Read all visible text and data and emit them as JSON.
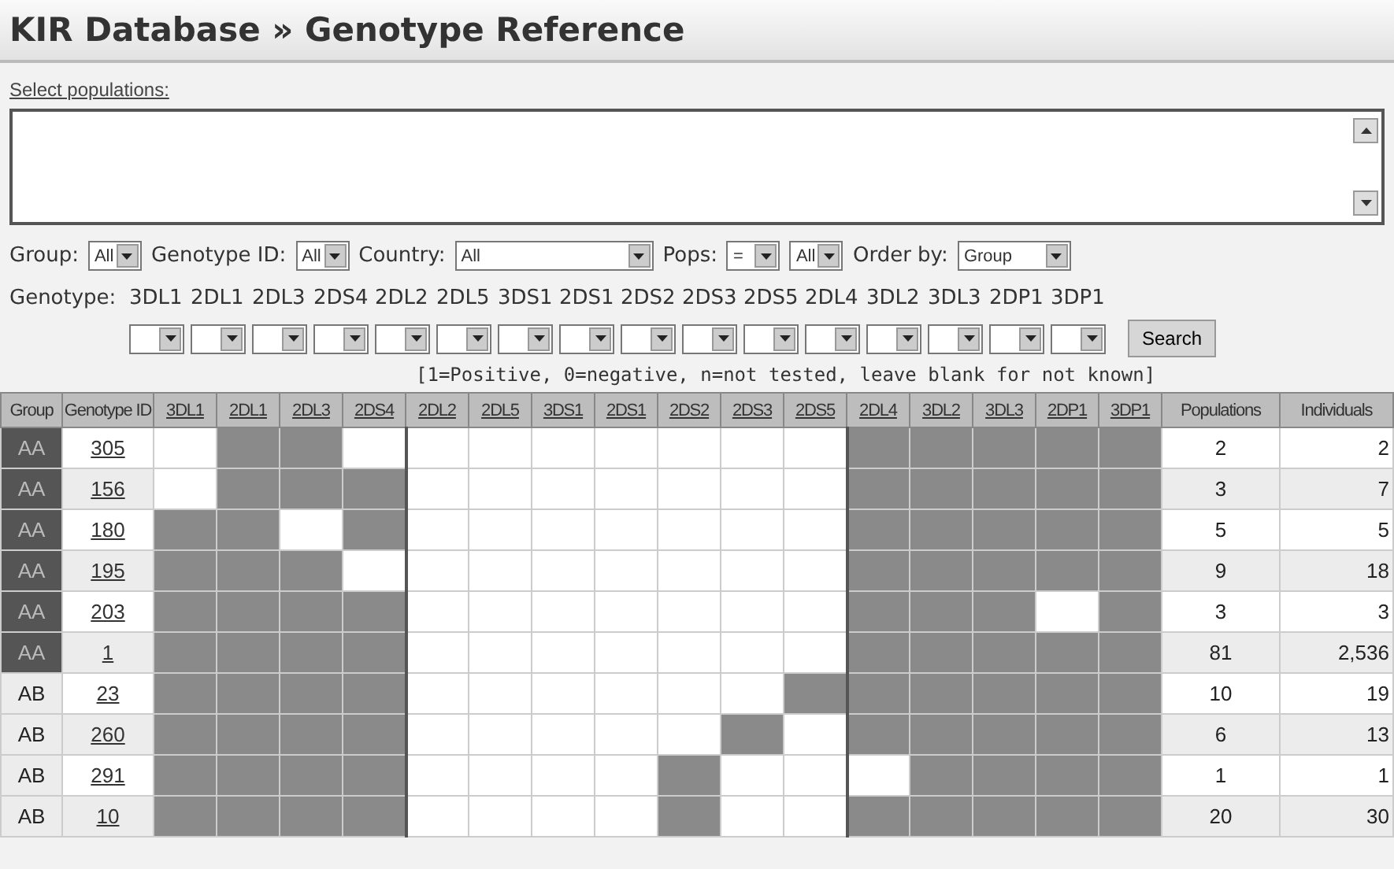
{
  "page_title": "KIR Database » Genotype Reference",
  "select_populations": {
    "label": "Select populations:"
  },
  "filters": [
    {
      "label": "Group:",
      "value": "All"
    },
    {
      "label": "Genotype ID:",
      "value": "All"
    },
    {
      "label": "Country:",
      "value": "All"
    },
    {
      "label": "Pops:",
      "value": "="
    },
    {
      "value": "All"
    },
    {
      "label": "Order by:",
      "value": "Group"
    }
  ],
  "genotype_label": "Genotype:",
  "genes": [
    "3DL1",
    "2DL1",
    "2DL3",
    "2DS4",
    "2DL2",
    "2DL5",
    "3DS1",
    "2DS1",
    "2DS2",
    "2DS3",
    "2DS5",
    "2DL4",
    "3DL2",
    "3DL3",
    "2DP1",
    "3DP1"
  ],
  "search_button": "Search",
  "hint": "[1=Positive, 0=negative, n=not tested, leave blank for not known]",
  "table": {
    "columns": {
      "group": "Group",
      "genotype_id": "Genotype ID",
      "genes": [
        "3DL1",
        "2DL1",
        "2DL3",
        "2DS4",
        "2DL2",
        "2DL5",
        "3DS1",
        "2DS1",
        "2DS2",
        "2DS3",
        "2DS5",
        "2DL4",
        "3DL2",
        "3DL3",
        "2DP1",
        "3DP1"
      ],
      "populations": "Populations",
      "individuals": "Individuals"
    },
    "rows": [
      {
        "group": "AA",
        "highlighted": true,
        "id": "305",
        "present": [
          false,
          true,
          true,
          false,
          false,
          false,
          false,
          false,
          false,
          false,
          false,
          true,
          true,
          true,
          true,
          true
        ],
        "populations": "2",
        "individuals": "2"
      },
      {
        "group": "AA",
        "highlighted": true,
        "id": "156",
        "present": [
          false,
          true,
          true,
          true,
          false,
          false,
          false,
          false,
          false,
          false,
          false,
          true,
          true,
          true,
          true,
          true
        ],
        "populations": "3",
        "individuals": "7"
      },
      {
        "group": "AA",
        "highlighted": true,
        "id": "180",
        "present": [
          true,
          true,
          false,
          true,
          false,
          false,
          false,
          false,
          false,
          false,
          false,
          true,
          true,
          true,
          true,
          true
        ],
        "populations": "5",
        "individuals": "5"
      },
      {
        "group": "AA",
        "highlighted": true,
        "id": "195",
        "present": [
          true,
          true,
          true,
          false,
          false,
          false,
          false,
          false,
          false,
          false,
          false,
          true,
          true,
          true,
          true,
          true
        ],
        "populations": "9",
        "individuals": "18"
      },
      {
        "group": "AA",
        "highlighted": true,
        "id": "203",
        "present": [
          true,
          true,
          true,
          true,
          false,
          false,
          false,
          false,
          false,
          false,
          false,
          true,
          true,
          true,
          false,
          true
        ],
        "populations": "3",
        "individuals": "3"
      },
      {
        "group": "AA",
        "highlighted": true,
        "id": "1",
        "present": [
          true,
          true,
          true,
          true,
          false,
          false,
          false,
          false,
          false,
          false,
          false,
          true,
          true,
          true,
          true,
          true
        ],
        "populations": "81",
        "individuals": "2,536"
      },
      {
        "group": "AB",
        "highlighted": false,
        "id": "23",
        "present": [
          true,
          true,
          true,
          true,
          false,
          false,
          false,
          false,
          false,
          false,
          true,
          true,
          true,
          true,
          true,
          true
        ],
        "populations": "10",
        "individuals": "19"
      },
      {
        "group": "AB",
        "highlighted": false,
        "id": "260",
        "present": [
          true,
          true,
          true,
          true,
          false,
          false,
          false,
          false,
          false,
          true,
          false,
          true,
          true,
          true,
          true,
          true
        ],
        "populations": "6",
        "individuals": "13"
      },
      {
        "group": "AB",
        "highlighted": false,
        "id": "291",
        "present": [
          true,
          true,
          true,
          true,
          false,
          false,
          false,
          false,
          true,
          false,
          false,
          false,
          true,
          true,
          true,
          true
        ],
        "populations": "1",
        "individuals": "1"
      },
      {
        "group": "AB",
        "highlighted": false,
        "id": "10",
        "present": [
          true,
          true,
          true,
          true,
          false,
          false,
          false,
          false,
          true,
          false,
          false,
          true,
          true,
          true,
          true,
          true
        ],
        "populations": "20",
        "individuals": "30"
      }
    ]
  }
}
